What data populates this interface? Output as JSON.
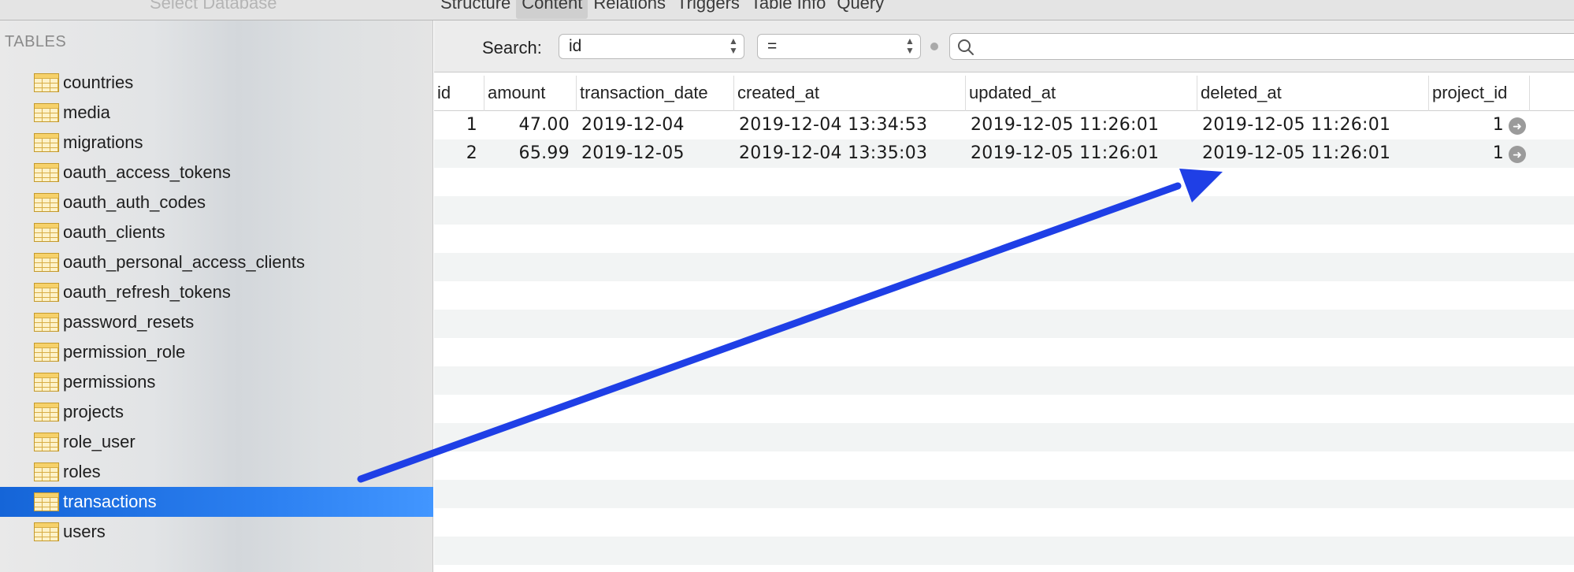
{
  "toolbar": {
    "database_select": "Select Database",
    "tabs": [
      {
        "label": "Structure"
      },
      {
        "label": "Content",
        "active": true
      },
      {
        "label": "Relations"
      },
      {
        "label": "Triggers"
      },
      {
        "label": "Table Info"
      },
      {
        "label": "Query"
      }
    ]
  },
  "sidebar": {
    "heading": "TABLES",
    "items": [
      {
        "label": "countries"
      },
      {
        "label": "media"
      },
      {
        "label": "migrations"
      },
      {
        "label": "oauth_access_tokens"
      },
      {
        "label": "oauth_auth_codes"
      },
      {
        "label": "oauth_clients"
      },
      {
        "label": "oauth_personal_access_clients"
      },
      {
        "label": "oauth_refresh_tokens"
      },
      {
        "label": "password_resets"
      },
      {
        "label": "permission_role"
      },
      {
        "label": "permissions"
      },
      {
        "label": "projects"
      },
      {
        "label": "role_user"
      },
      {
        "label": "roles"
      },
      {
        "label": "transactions",
        "selected": true
      },
      {
        "label": "users"
      }
    ],
    "table_icon": "table-icon"
  },
  "filter": {
    "label": "Search:",
    "field_value": "id",
    "operator_value": "=",
    "search_value": "",
    "search_icon": "magnifier-icon"
  },
  "grid": {
    "columns": [
      "id",
      "amount",
      "transaction_date",
      "created_at",
      "updated_at",
      "deleted_at",
      "project_id"
    ],
    "rows": [
      [
        "1",
        "47.00",
        "2019-12-04",
        "2019-12-04 13:34:53",
        "2019-12-05 11:26:01",
        "2019-12-05 11:26:01",
        "1"
      ],
      [
        "2",
        "65.99",
        "2019-12-05",
        "2019-12-04 13:35:03",
        "2019-12-05 11:26:01",
        "2019-12-05 11:26:01",
        "1"
      ]
    ],
    "fk_icon": "arrow-right-circle-icon"
  },
  "annotation": {
    "color": "#1f3fe6",
    "shape": "arrow"
  },
  "colors": {
    "selection": "#1a6ee6",
    "accent_arrow": "#1f3fe6"
  }
}
